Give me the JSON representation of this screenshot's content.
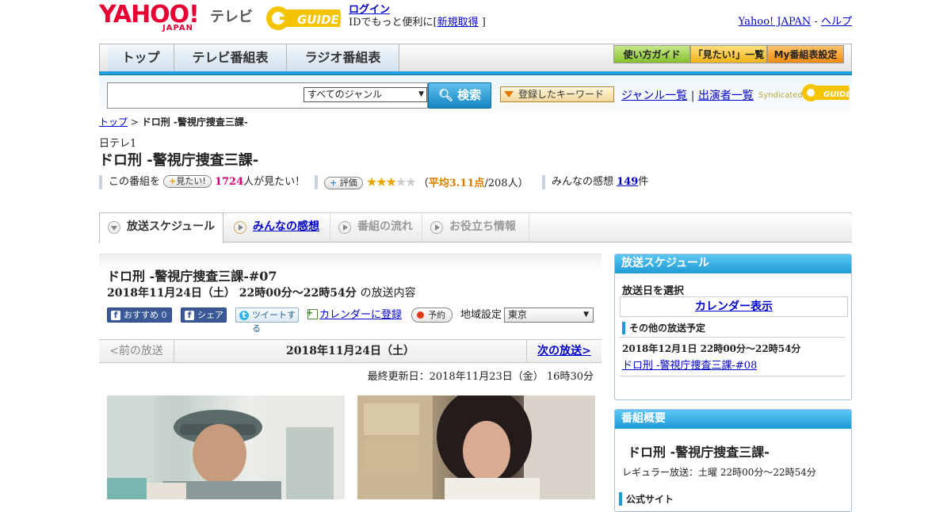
{
  "header": {
    "logo_main": "YAHOO!",
    "logo_sub": "JAPAN",
    "logo_tv": "テレビ",
    "gguide_logo": "G GUIDE",
    "login_label": "ログイン",
    "login_desc": "IDでもっと便利に[",
    "signup_label": "新規取得",
    "bracket_close": "]",
    "yahoo_japan_link": "Yahoo! JAPAN",
    "separator": "-",
    "help_link": "ヘルプ"
  },
  "nav": {
    "tabs": [
      "トップ",
      "テレビ番組表",
      "ラジオ番組表"
    ],
    "right_buttons": [
      "使い方ガイド",
      "「見たい!」一覧",
      "My番組表設定"
    ]
  },
  "search": {
    "input_value": "",
    "genre_selected": "すべてのジャンル",
    "search_button": "検索",
    "keyword_button": "登録したキーワード",
    "genre_list_link": "ジャンル一覧",
    "divider": "|",
    "performer_link": "出演者一覧",
    "syndicated": "Syndicated"
  },
  "breadcrumb": {
    "top": "トップ",
    "sep": ">",
    "current": "ドロ刑 -警視庁捜査三課-"
  },
  "program": {
    "station": "日テレ1",
    "title": "ドロ刑 -警視庁捜査三課-",
    "want_prefix": "この番組を",
    "want_button": "見たい!",
    "want_count": "1724",
    "want_suffix": "人が見たい！",
    "rate_button": "評価",
    "rating": 3,
    "rating_max": 5,
    "avg_prefix": "（",
    "avg_text": "平均3.11点",
    "avg_count": "/208人）",
    "impression_prefix": "みんなの感想",
    "impression_count": "149",
    "impression_suffix": "件"
  },
  "ptabs": {
    "schedule": "放送スケジュール",
    "impressions": "みんなの感想",
    "flow": "番組の流れ",
    "useful": "お役立ち情報"
  },
  "episode": {
    "title": "ドロ刑 -警視庁捜査三課-#07",
    "date": "2018年11月24日（土） 22時00分～22時54分",
    "date_suffix": "の放送内容",
    "recommend_label": "おすすめ",
    "recommend_count": "0",
    "share_label": "シェア",
    "tweet_label": "ツイートする",
    "calendar_label": "カレンダーに登録",
    "reserve_label": "予約",
    "region_label": "地域設定",
    "region_value": "東京"
  },
  "datenav": {
    "prev": "<前の放送",
    "current": "2018年11月24日（土）",
    "next": "次の放送>"
  },
  "updated": "最終更新日：2018年11月23日（金） 16時30分",
  "sidebar": {
    "schedule_header": "放送スケジュール",
    "select_day": "放送日を選択",
    "calendar_button": "カレンダー表示",
    "other_label": "その他の放送予定",
    "next_datetime": "2018年12月1日 22時00分～22時54分",
    "next_link": "ドロ刑 -警視庁捜査三課-#08",
    "summary_header": "番組概要",
    "summary_title": "ドロ刑 -警視庁捜査三課-",
    "regular": "レギュラー放送：土曜 22時00分～22時54分",
    "official_label": "公式サイト"
  },
  "colors": {
    "accent_blue": "#1ca0df",
    "yahoo_red": "#e60033",
    "gguide_yellow": "#f5c400",
    "want_pink": "#d6006f",
    "rating_orange": "#d67a00"
  }
}
